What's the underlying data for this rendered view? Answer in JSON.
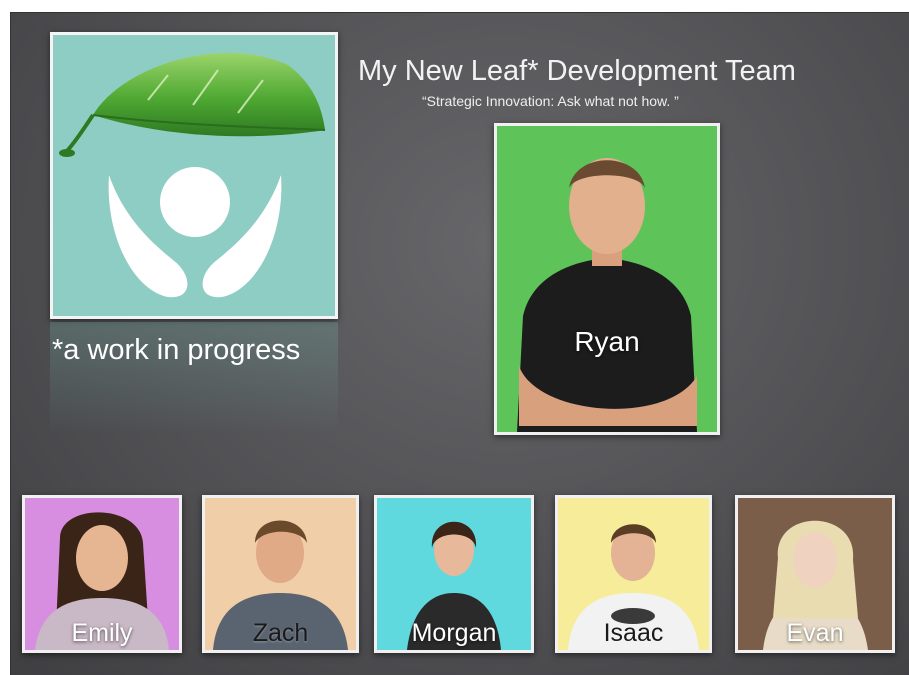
{
  "slide": {
    "title": "My New Leaf* Development Team",
    "subtitle": "“Strategic Innovation: Ask what not how. ”",
    "logo_caption": "*a work in progress",
    "lead": {
      "name": "Ryan",
      "bg": "#5ec45a"
    },
    "team": [
      {
        "name": "Emily",
        "bg": "#d88ee0"
      },
      {
        "name": "Zach",
        "bg": "#f0cfa8"
      },
      {
        "name": "Morgan",
        "bg": "#5fd8de"
      },
      {
        "name": "Isaac",
        "bg": "#f6ec9a"
      },
      {
        "name": "Evan",
        "bg": "#8a6a55"
      }
    ]
  },
  "colors": {
    "logo_bg": "#8ecdc3",
    "leaf_green": "#3f9a2e",
    "text": "#ffffff"
  }
}
